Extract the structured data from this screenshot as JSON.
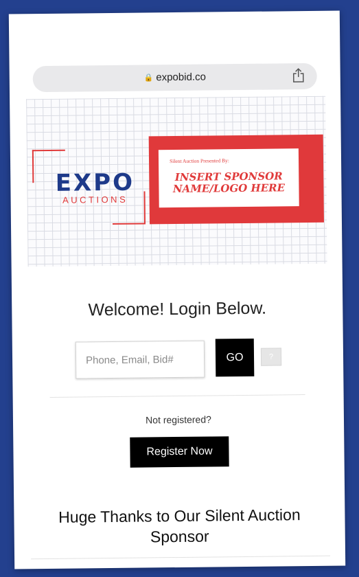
{
  "browser": {
    "url": "expobid.co",
    "lock_icon": "lock-icon",
    "share_icon": "share-icon"
  },
  "banner": {
    "logo_main": "EXPO",
    "logo_sub": "AUCTIONS",
    "sponsor_small": "Silent Auction Presented By:",
    "sponsor_line1": "INSERT SPONSOR",
    "sponsor_line2": "NAME/LOGO HERE",
    "colors": {
      "brand_blue": "#1e3a8a",
      "brand_red": "#e03a3a"
    }
  },
  "login": {
    "heading": "Welcome! Login Below.",
    "input_placeholder": "Phone, Email, Bid#",
    "input_value": "",
    "go_label": "GO",
    "help_label": "?"
  },
  "register": {
    "prompt": "Not registered?",
    "button_label": "Register Now"
  },
  "sponsor_section": {
    "heading": "Huge Thanks to Our Silent Auction Sponsor"
  }
}
